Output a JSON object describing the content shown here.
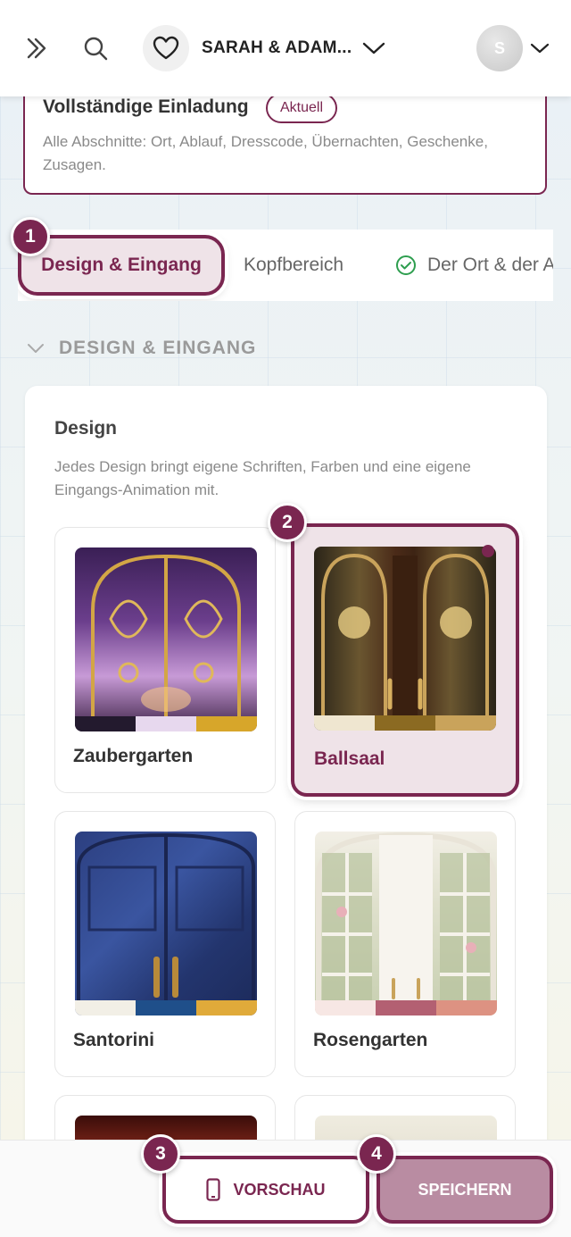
{
  "header": {
    "couple_name": "SARAH & ADAM...",
    "avatar_initial": "S"
  },
  "invitation_card": {
    "title": "Vollständige Einladung",
    "badge": "Aktuell",
    "description": "Alle Abschnitte: Ort, Ablauf, Dresscode, Übernachten, Geschenke, Zusagen."
  },
  "tabs": [
    {
      "label": "Design & Eingang",
      "active": true
    },
    {
      "label": "Kopfbereich",
      "active": false
    },
    {
      "label": "Der Ort & der Ablauf",
      "active": false,
      "completed": true
    }
  ],
  "section": {
    "title": "DESIGN & EINGANG"
  },
  "design_panel": {
    "title": "Design",
    "description": "Jedes Design bringt eigene Schriften, Farben und eine eigene Eingangs-Animation mit.",
    "designs": [
      {
        "name": "Zaubergarten",
        "selected": false,
        "swatches": [
          "#231a2e",
          "#e7d8ee",
          "#d7a62a"
        ]
      },
      {
        "name": "Ballsaal",
        "selected": true,
        "swatches": [
          "#efe6d0",
          "#8b6a22",
          "#c9a35b"
        ]
      },
      {
        "name": "Santorini",
        "selected": false,
        "swatches": [
          "#f2efe6",
          "#1f4f8a",
          "#e0aa3a"
        ]
      },
      {
        "name": "Rosengarten",
        "selected": false,
        "swatches": [
          "#f7e7e4",
          "#b36072",
          "#dd9282"
        ]
      }
    ]
  },
  "step_badges": [
    "1",
    "2",
    "3",
    "4"
  ],
  "footer": {
    "preview_label": "VORSCHAU",
    "save_label": "SPEICHERN"
  },
  "colors": {
    "accent": "#7a2650",
    "accent_light": "#efe3e8",
    "save_button": "#b98ca2"
  }
}
